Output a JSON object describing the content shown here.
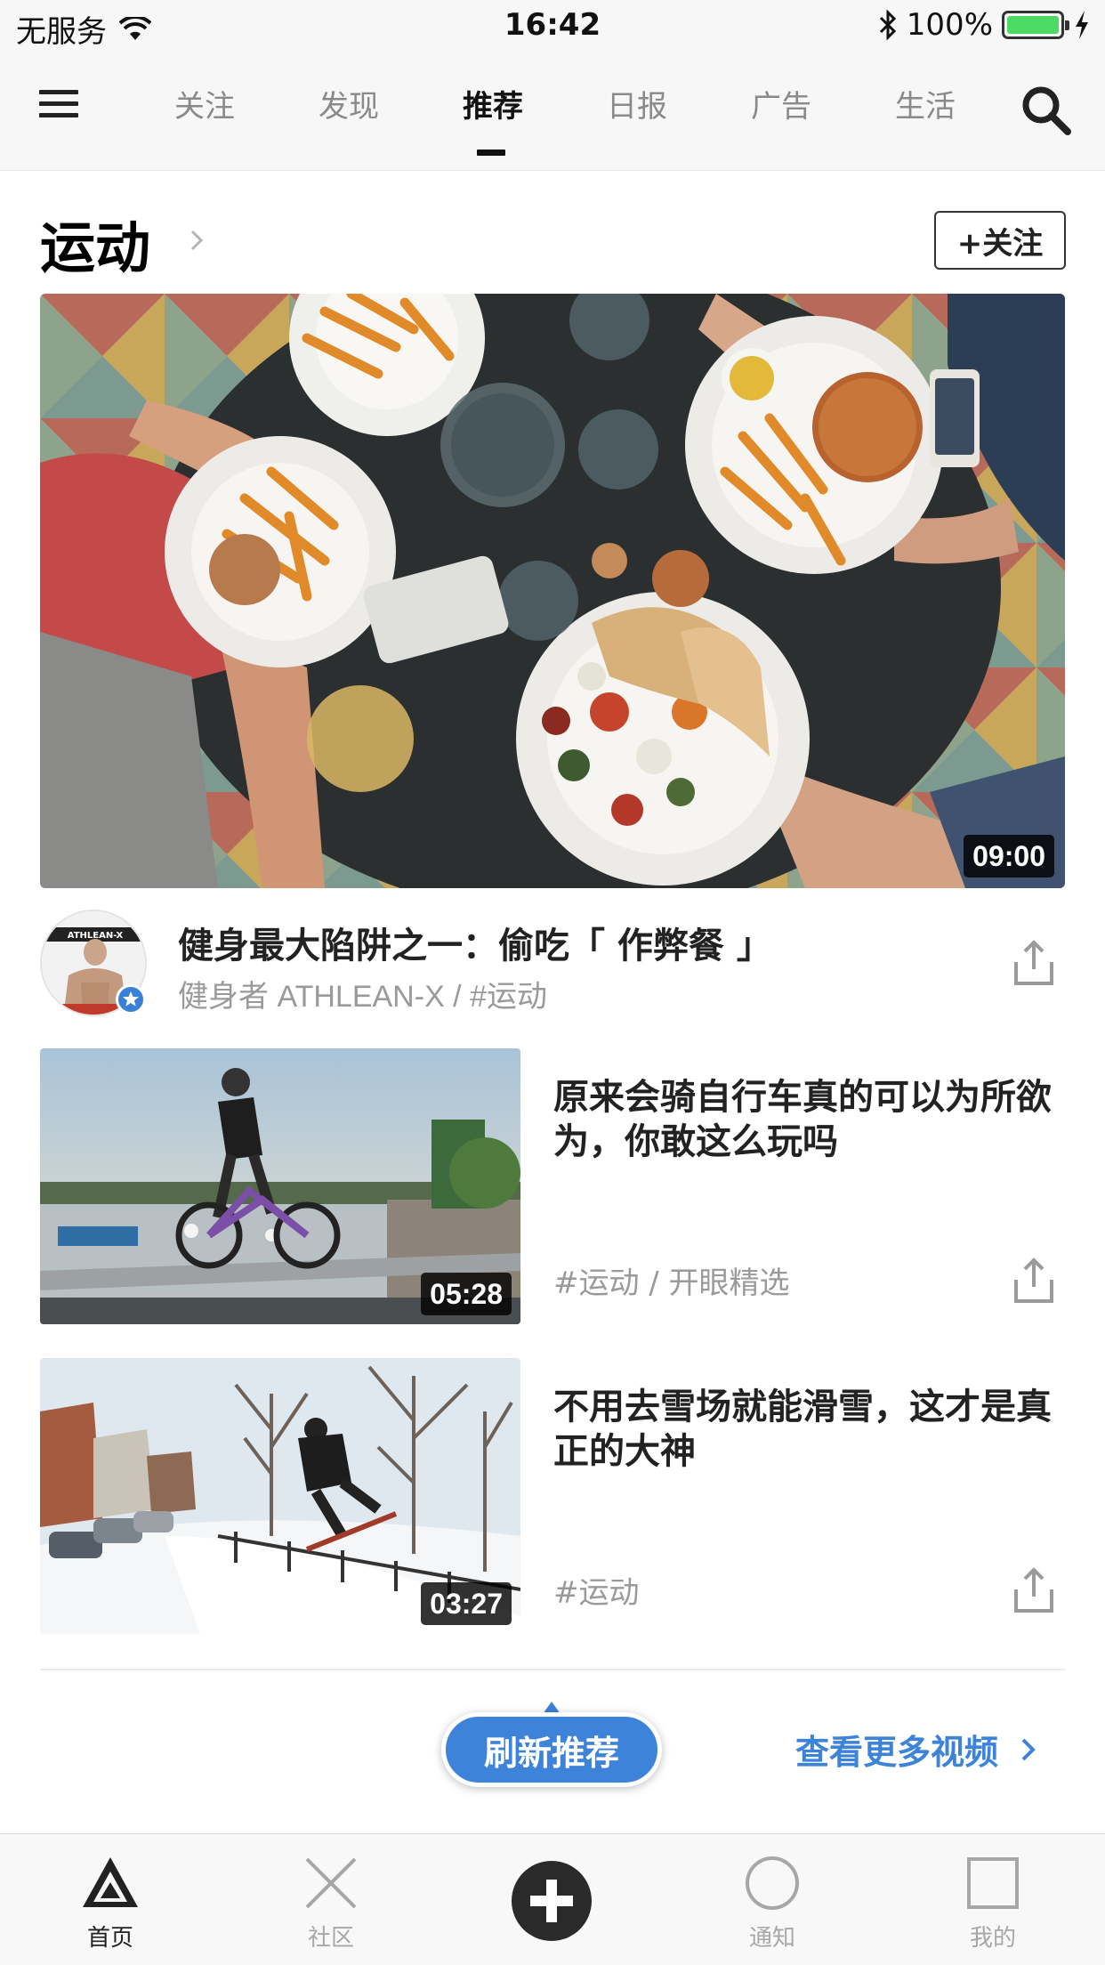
{
  "status_bar": {
    "carrier": "无服务",
    "time": "16:42",
    "battery": "100%",
    "battery_level": 1.0
  },
  "top_nav": {
    "tabs": [
      {
        "label": "关注",
        "active": false
      },
      {
        "label": "发现",
        "active": false
      },
      {
        "label": "推荐",
        "active": true
      },
      {
        "label": "日报",
        "active": false
      },
      {
        "label": "广告",
        "active": false
      },
      {
        "label": "生活",
        "active": false
      }
    ]
  },
  "section": {
    "title": "运动",
    "follow_label": "+关注"
  },
  "featured": {
    "duration": "09:00",
    "title": "健身最大陷阱之一：偷吃「 作弊餐 」",
    "meta": "健身者 ATHLEAN-X  /  #运动",
    "avatar_text": "ATHLEAN-X"
  },
  "videos": [
    {
      "title": "原来会骑自行车真的可以为所欲为，你敢这么玩吗",
      "meta": "#运动  /  开眼精选",
      "duration": "05:28"
    },
    {
      "title": "不用去雪场就能滑雪，这才是真正的大神",
      "meta": "#运动",
      "duration": "03:27"
    }
  ],
  "footer_actions": {
    "refresh_label": "刷新推荐",
    "more_label": "查看更多视频"
  },
  "tab_bar": {
    "items": [
      {
        "label": "首页",
        "icon": "home-triangle-icon",
        "active": true
      },
      {
        "label": "社区",
        "icon": "community-x-icon",
        "active": false
      },
      {
        "label": "",
        "icon": "plus-circle-icon",
        "active": false
      },
      {
        "label": "通知",
        "icon": "notification-circle-icon",
        "active": false
      },
      {
        "label": "我的",
        "icon": "profile-square-icon",
        "active": false
      }
    ]
  },
  "colors": {
    "accent": "#3d83d9",
    "battery_green": "#4cd964",
    "text_primary": "#222222",
    "text_secondary": "#9a9a9a"
  }
}
